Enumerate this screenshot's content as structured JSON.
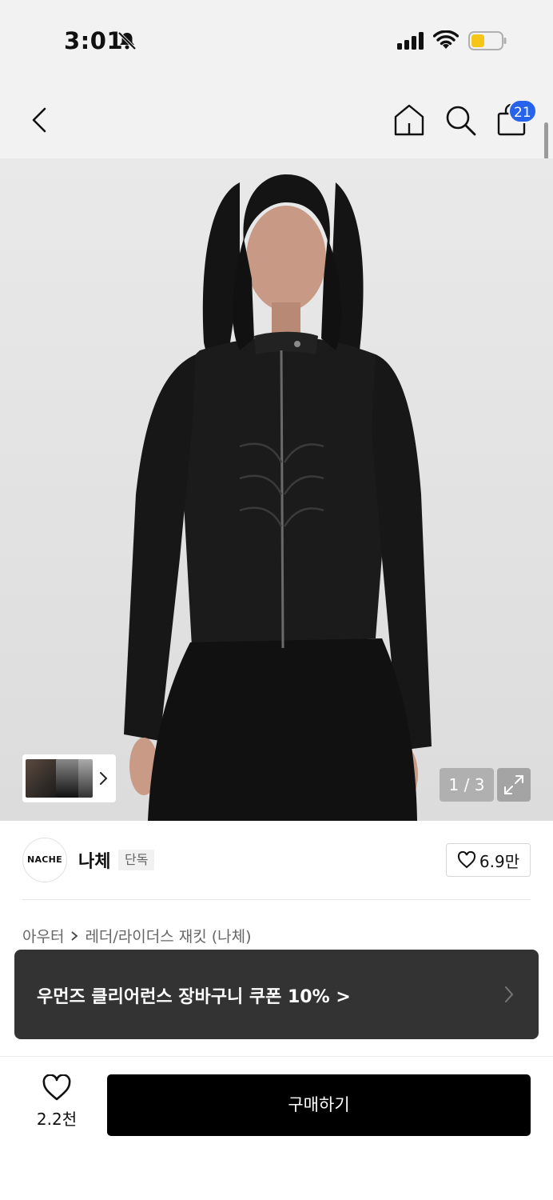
{
  "status_bar": {
    "time": "3:01",
    "icons": [
      "bell-muted-icon",
      "cellular-signal-icon",
      "wifi-icon",
      "battery-icon"
    ],
    "battery_color": "#f5c518"
  },
  "header": {
    "icons": [
      "back-icon",
      "home-icon",
      "search-icon",
      "shopping-bag-icon"
    ],
    "cart_count": "21",
    "badge_color": "#2563eb"
  },
  "gallery": {
    "counter": "1 / 3",
    "icons": [
      "chevron-right-icon",
      "expand-icon"
    ]
  },
  "brand": {
    "logo_text": "NACHE",
    "name": "나체",
    "tag": "단독",
    "like_count": "6.9만"
  },
  "breadcrumb": {
    "items": [
      "아우터",
      "레더/라이더스 재킷 (나체)"
    ]
  },
  "coupon": {
    "text": "우먼즈 클리어런스 장바구니 쿠폰 10% >"
  },
  "bottom_bar": {
    "wish_count": "2.2천",
    "buy_label": "구매하기"
  }
}
